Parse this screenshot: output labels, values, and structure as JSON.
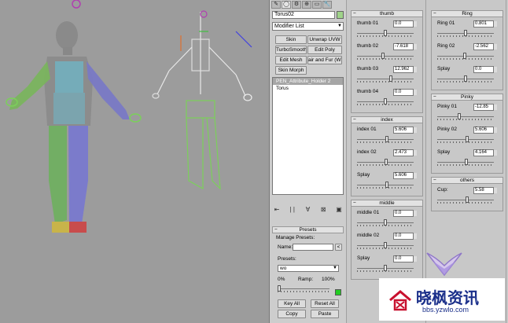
{
  "viewport": {
    "label": "3D viewport - character rig"
  },
  "command_panel": {
    "tabs": [
      "✎",
      "◯",
      "⚙",
      "⊕",
      "▭",
      "🔧"
    ],
    "object_name": "Torus02",
    "modifier_list": "Modifier List",
    "buttons": [
      "Skin",
      "Unwrap UVW",
      "TurboSmooth",
      "Edit Poly",
      "Edit Mesh",
      "air and Fur (WS",
      "Skin Morph"
    ],
    "stack": [
      {
        "label": "PEN_Attribute_Holder 2",
        "selected": true
      },
      {
        "label": "Torus",
        "selected": false
      }
    ],
    "stack_tools": [
      "⇤",
      "| |",
      "∀",
      "⊠",
      "▣"
    ],
    "presets": {
      "header": "Presets",
      "manage_label": "Manage Presets:",
      "name_label": "Name:",
      "name_value": "",
      "name_button": "<",
      "presets_label": "Presets:",
      "presets_value": "wo",
      "pct_min": "0%",
      "ramp": "Ramp:",
      "pct_max": "100%",
      "ramp_fraction": 0.0,
      "key_all": "Key All",
      "reset_all": "Reset All",
      "copy": "Copy",
      "paste": "Paste"
    }
  },
  "rollouts": {
    "col1": [
      {
        "header": "thumb",
        "fields": [
          {
            "label": "thumb 01",
            "value": "0.0",
            "frac": 0.5
          },
          {
            "label": "thumb 02",
            "value": "-7.618",
            "frac": 0.45
          },
          {
            "label": "thumb 03",
            "value": "12.962",
            "frac": 0.6
          },
          {
            "label": "thumb 04",
            "value": "0.0",
            "frac": 0.5
          }
        ]
      },
      {
        "header": "index",
        "fields": [
          {
            "label": "index 01",
            "value": "5.606",
            "frac": 0.53
          },
          {
            "label": "index 02",
            "value": "2.473",
            "frac": 0.51
          },
          {
            "label": "Splay",
            "value": "5.606",
            "frac": 0.53
          }
        ]
      },
      {
        "header": "middle",
        "fields": [
          {
            "label": "middle 01",
            "value": "0.0",
            "frac": 0.5
          },
          {
            "label": "middle 02",
            "value": "0.0",
            "frac": 0.5
          },
          {
            "label": "Splay",
            "value": "0.0",
            "frac": 0.5
          }
        ]
      }
    ],
    "col2": [
      {
        "header": "Ring",
        "fields": [
          {
            "label": "Ring 01",
            "value": "0.801",
            "frac": 0.5
          },
          {
            "label": "Ring 02",
            "value": "-2.562",
            "frac": 0.48
          },
          {
            "label": "Splay",
            "value": "0.0",
            "frac": 0.5
          }
        ]
      },
      {
        "header": "Pinky",
        "fields": [
          {
            "label": "Pinky 01",
            "value": "-12.85",
            "frac": 0.38
          },
          {
            "label": "Pinky 02",
            "value": "5.606",
            "frac": 0.53
          },
          {
            "label": "Splay",
            "value": "4.164",
            "frac": 0.52
          }
        ]
      },
      {
        "header": "others",
        "fields": [
          {
            "label": "Cup:",
            "value": "5.58",
            "frac": 0.53
          }
        ]
      }
    ]
  },
  "watermark": {
    "title": "晓枫资讯",
    "url": "bbs.yzwlo.com"
  },
  "colors": {
    "viewport_bg": "#9c9c9c",
    "panel_bg": "#c8c8c8",
    "selected": "#a6a6a6"
  }
}
